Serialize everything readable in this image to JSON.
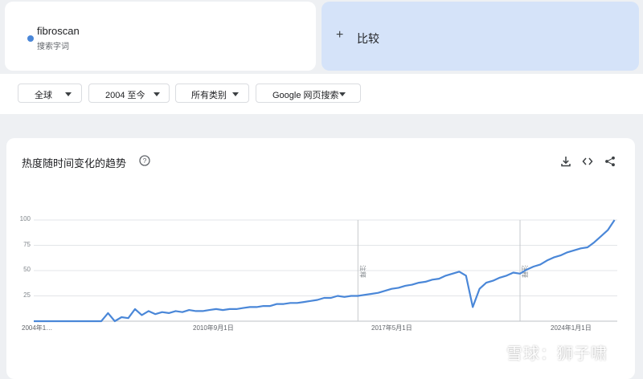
{
  "term": {
    "name": "fibroscan",
    "subtitle": "搜索字词",
    "color": "#4a87d8"
  },
  "compare": {
    "label": "比较"
  },
  "filters": [
    {
      "label": "全球"
    },
    {
      "label": "2004 至今"
    },
    {
      "label": "所有类别"
    },
    {
      "label": "Google 网页搜索"
    }
  ],
  "chart_section": {
    "title": "热度随时间变化的趋势"
  },
  "icons": [
    "help-icon",
    "download-icon",
    "embed-icon",
    "share-icon"
  ],
  "watermark": {
    "text": "雪球：狮子啸"
  },
  "chart_data": {
    "type": "line",
    "title": "",
    "xlabel": "",
    "ylabel": "",
    "ylim": [
      0,
      100
    ],
    "yticks": [
      25,
      50,
      75,
      100
    ],
    "xtick_labels": [
      "2004年1…",
      "2010年9月1日",
      "2017年5月1日",
      "2024年1月1日"
    ],
    "annotations": [
      {
        "x": "2016-01",
        "text": "注释"
      },
      {
        "x": "2022-01",
        "text": "注释"
      }
    ],
    "series": [
      {
        "color": "#4a87d8",
        "points": [
          [
            "2004-01",
            0
          ],
          [
            "2004-07",
            0
          ],
          [
            "2005-01",
            0
          ],
          [
            "2005-07",
            0
          ],
          [
            "2006-01",
            0
          ],
          [
            "2006-07",
            0
          ],
          [
            "2006-10",
            8
          ],
          [
            "2007-01",
            0
          ],
          [
            "2007-04",
            4
          ],
          [
            "2007-07",
            3
          ],
          [
            "2007-10",
            12
          ],
          [
            "2008-01",
            6
          ],
          [
            "2008-04",
            10
          ],
          [
            "2008-07",
            7
          ],
          [
            "2008-10",
            9
          ],
          [
            "2009-01",
            8
          ],
          [
            "2009-04",
            10
          ],
          [
            "2009-07",
            9
          ],
          [
            "2009-10",
            11
          ],
          [
            "2010-01",
            10
          ],
          [
            "2010-04",
            10
          ],
          [
            "2010-07",
            11
          ],
          [
            "2010-10",
            12
          ],
          [
            "2011-01",
            11
          ],
          [
            "2011-04",
            12
          ],
          [
            "2011-07",
            12
          ],
          [
            "2011-10",
            13
          ],
          [
            "2012-01",
            14
          ],
          [
            "2012-04",
            14
          ],
          [
            "2012-07",
            15
          ],
          [
            "2012-10",
            15
          ],
          [
            "2013-01",
            17
          ],
          [
            "2013-04",
            17
          ],
          [
            "2013-07",
            18
          ],
          [
            "2013-10",
            18
          ],
          [
            "2014-01",
            19
          ],
          [
            "2014-04",
            20
          ],
          [
            "2014-07",
            21
          ],
          [
            "2014-10",
            23
          ],
          [
            "2015-01",
            23
          ],
          [
            "2015-04",
            25
          ],
          [
            "2015-07",
            24
          ],
          [
            "2015-10",
            25
          ],
          [
            "2016-01",
            25
          ],
          [
            "2016-04",
            26
          ],
          [
            "2016-07",
            27
          ],
          [
            "2016-10",
            28
          ],
          [
            "2017-01",
            30
          ],
          [
            "2017-04",
            32
          ],
          [
            "2017-07",
            33
          ],
          [
            "2017-10",
            35
          ],
          [
            "2018-01",
            36
          ],
          [
            "2018-04",
            38
          ],
          [
            "2018-07",
            39
          ],
          [
            "2018-10",
            41
          ],
          [
            "2019-01",
            42
          ],
          [
            "2019-04",
            45
          ],
          [
            "2019-07",
            47
          ],
          [
            "2019-10",
            49
          ],
          [
            "2020-01",
            45
          ],
          [
            "2020-04",
            14
          ],
          [
            "2020-07",
            32
          ],
          [
            "2020-10",
            38
          ],
          [
            "2021-01",
            40
          ],
          [
            "2021-04",
            43
          ],
          [
            "2021-07",
            45
          ],
          [
            "2021-10",
            48
          ],
          [
            "2022-01",
            47
          ],
          [
            "2022-04",
            51
          ],
          [
            "2022-07",
            54
          ],
          [
            "2022-10",
            56
          ],
          [
            "2023-01",
            60
          ],
          [
            "2023-04",
            63
          ],
          [
            "2023-07",
            65
          ],
          [
            "2023-10",
            68
          ],
          [
            "2024-01",
            70
          ],
          [
            "2024-04",
            72
          ],
          [
            "2024-07",
            73
          ],
          [
            "2024-10",
            78
          ],
          [
            "2025-01",
            84
          ],
          [
            "2025-04",
            90
          ],
          [
            "2025-07",
            100
          ]
        ]
      }
    ]
  }
}
